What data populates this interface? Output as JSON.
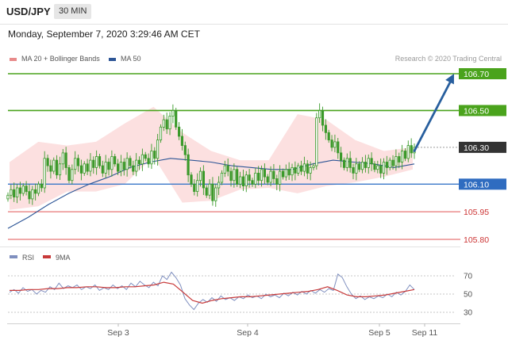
{
  "header": {
    "symbol": "USD/JPY",
    "timeframe": "30 MIN",
    "datetime": "Monday, September 7, 2020 3:29:46 AM CET"
  },
  "legend": {
    "ma20_label": "MA 20 + Bollinger Bands",
    "ma50_label": "MA 50",
    "watermark": "Research © 2020 Trading Central"
  },
  "colors": {
    "ma20": "#e88a8a",
    "bollinger_fill": "#fbdada",
    "ma50": "#2d5596",
    "resistance": "#4aa31c",
    "pivot": "#333333",
    "support_line": "#3a78c9",
    "support_label": "#2f6cc0",
    "lower_support": "#e05555",
    "lower_support_text": "#cc3333",
    "arrow": "#285f9e",
    "candle": "#3a9a2a",
    "rsi": "#7f8fbf",
    "rsi_ma": "#c83a3a"
  },
  "chart_data": [
    {
      "type": "candlestick",
      "symbol": "USD/JPY",
      "timeframe": "30 MIN",
      "x_ticks": [
        "Sep 3",
        "Sep 4",
        "Sep 5",
        "Sep 11"
      ],
      "ylim": [
        105.75,
        106.75
      ],
      "y_labels": [
        {
          "value": 106.7,
          "label": "106.70",
          "role": "resistance"
        },
        {
          "value": 106.5,
          "label": "106.50",
          "role": "resistance"
        },
        {
          "value": 106.3,
          "label": "106.30",
          "role": "pivot"
        },
        {
          "value": 106.1,
          "label": "106.10",
          "role": "support"
        },
        {
          "value": 105.95,
          "label": "105.95",
          "role": "support-minor"
        },
        {
          "value": 105.8,
          "label": "105.80",
          "role": "support-minor"
        }
      ],
      "candles_close": [
        106.04,
        106.07,
        106.03,
        106.08,
        106.05,
        106.09,
        106.06,
        106.02,
        106.07,
        106.05,
        106.1,
        106.08,
        106.24,
        106.2,
        106.17,
        106.23,
        106.15,
        106.21,
        106.27,
        106.19,
        106.12,
        106.18,
        106.24,
        106.2,
        106.16,
        106.21,
        106.17,
        106.23,
        106.19,
        106.25,
        106.2,
        106.16,
        106.22,
        106.18,
        106.25,
        106.21,
        106.17,
        106.22,
        106.18,
        106.24,
        106.2,
        106.17,
        106.23,
        106.21,
        106.26,
        106.24,
        106.21,
        106.28,
        106.24,
        106.34,
        106.41,
        106.45,
        106.4,
        106.47,
        106.5,
        106.41,
        106.36,
        106.31,
        106.26,
        106.15,
        106.1,
        106.06,
        106.12,
        106.17,
        106.08,
        106.04,
        106.1,
        106.01,
        106.08,
        106.11,
        106.16,
        106.2,
        106.17,
        106.12,
        106.18,
        106.1,
        106.14,
        106.09,
        106.15,
        106.12,
        106.1,
        106.16,
        106.12,
        106.18,
        106.14,
        106.11,
        106.17,
        106.13,
        106.1,
        106.17,
        106.14,
        106.18,
        106.15,
        106.19,
        106.16,
        106.2,
        106.17,
        106.21,
        106.16,
        106.19,
        106.2,
        106.46,
        106.5,
        106.42,
        106.38,
        106.34,
        106.3,
        106.33,
        106.27,
        106.23,
        106.19,
        106.24,
        106.19,
        106.16,
        106.21,
        106.18,
        106.22,
        106.19,
        106.24,
        106.21,
        106.18,
        106.2,
        106.16,
        106.22,
        106.19,
        106.23,
        106.2,
        106.25,
        106.22,
        106.28,
        106.24,
        106.31,
        106.27,
        106.3
      ],
      "ma50": [
        105.86,
        105.92,
        105.99,
        106.05,
        106.1,
        106.14,
        106.19,
        106.22,
        106.24,
        106.23,
        106.22,
        106.2,
        106.19,
        106.18,
        106.18,
        106.21,
        106.23,
        106.22,
        106.21,
        106.19,
        106.21
      ],
      "bollinger_upper": [
        106.22,
        106.33,
        106.31,
        106.33,
        106.43,
        106.52,
        106.38,
        106.28,
        106.23,
        106.23,
        106.48,
        106.45,
        106.34,
        106.28,
        106.3
      ],
      "bollinger_lower": [
        105.96,
        105.98,
        106.06,
        106.06,
        106.1,
        106.25,
        106.0,
        106.01,
        106.07,
        106.08,
        106.05,
        106.09,
        106.11,
        106.14,
        106.18
      ],
      "projection": {
        "from": 106.28,
        "to": 106.7
      }
    },
    {
      "type": "line",
      "title": "RSI",
      "series": [
        {
          "name": "RSI"
        },
        {
          "name": "9MA"
        }
      ],
      "ylim": [
        25,
        80
      ],
      "y_ticks": [
        70,
        50,
        30
      ],
      "rsi": [
        52,
        55,
        51,
        57,
        53,
        55,
        50,
        54,
        52,
        58,
        55,
        62,
        56,
        59,
        57,
        60,
        55,
        58,
        56,
        60,
        54,
        57,
        55,
        60,
        56,
        59,
        55,
        62,
        58,
        64,
        60,
        57,
        63,
        59,
        70,
        66,
        74,
        68,
        60,
        45,
        38,
        33,
        40,
        44,
        41,
        46,
        42,
        48,
        44,
        46,
        43,
        47,
        45,
        49,
        46,
        48,
        45,
        50,
        47,
        49,
        46,
        51,
        48,
        52,
        49,
        53,
        50,
        54,
        51,
        55,
        52,
        56,
        54,
        72,
        68,
        58,
        50,
        45,
        48,
        44,
        47,
        45,
        48,
        46,
        50,
        47,
        52,
        49,
        53,
        60,
        55
      ],
      "rsi_ma": [
        54,
        54,
        55,
        55,
        56,
        56,
        57,
        57,
        58,
        58,
        57,
        57,
        58,
        58,
        59,
        60,
        63,
        61,
        52,
        43,
        40,
        43,
        45,
        46,
        47,
        47,
        48,
        49,
        50,
        51,
        52,
        53,
        55,
        58,
        54,
        49,
        47,
        47,
        48,
        49,
        51,
        53,
        55
      ]
    }
  ]
}
